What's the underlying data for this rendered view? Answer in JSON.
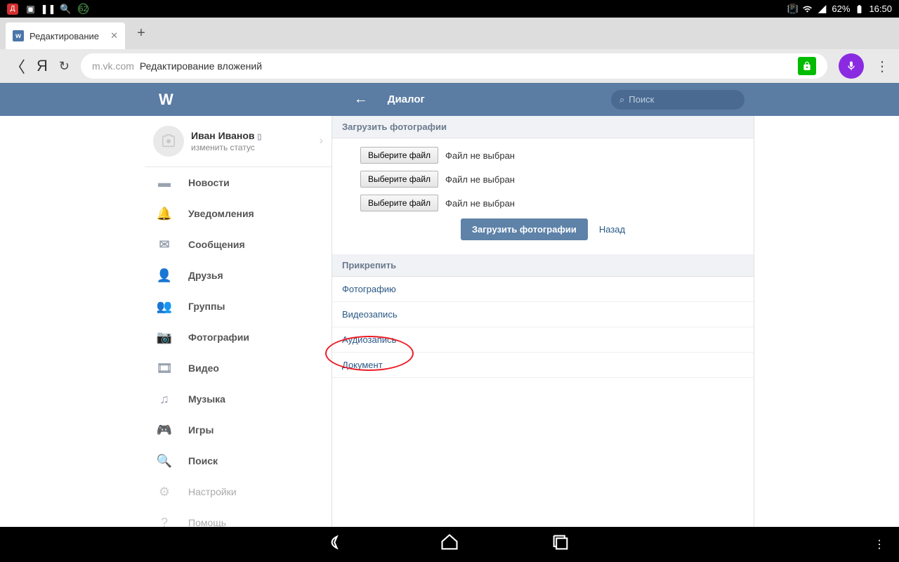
{
  "status": {
    "battery": "62%",
    "time": "16:50",
    "badge_num": "62"
  },
  "tab": {
    "title": "Редактирование"
  },
  "browser": {
    "host": "m.vk.com",
    "page_title": "Редактирование вложений"
  },
  "vk_header": {
    "title": "Диалог",
    "search_placeholder": "Поиск"
  },
  "profile": {
    "name": "Иван Иванов",
    "status": "изменить статус"
  },
  "nav": {
    "news": "Новости",
    "notifications": "Уведомления",
    "messages": "Сообщения",
    "friends": "Друзья",
    "groups": "Группы",
    "photos": "Фотографии",
    "video": "Видео",
    "music": "Музыка",
    "games": "Игры",
    "search": "Поиск",
    "settings": "Настройки",
    "help": "Помощь"
  },
  "upload": {
    "section_title": "Загрузить фотографии",
    "choose_file": "Выберите файл",
    "no_file": "Файл не выбран",
    "upload_btn": "Загрузить фотографии",
    "back": "Назад"
  },
  "attach": {
    "section_title": "Прикрепить",
    "photo": "Фотографию",
    "video": "Видеозапись",
    "audio": "Аудиозапись",
    "doc": "Документ"
  }
}
